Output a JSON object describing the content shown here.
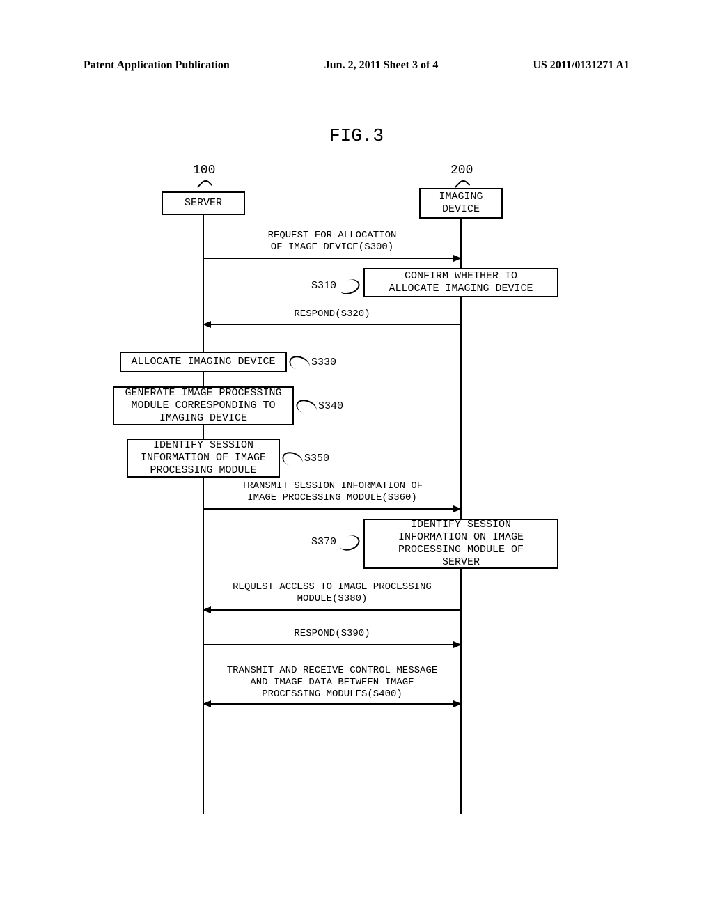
{
  "header": {
    "left": "Patent Application Publication",
    "center": "Jun. 2, 2011  Sheet 3 of 4",
    "right": "US 2011/0131271 A1"
  },
  "figure_title": "FIG.3",
  "refs": {
    "server": "100",
    "device": "200"
  },
  "entities": {
    "server": "SERVER",
    "device": "IMAGING\nDEVICE"
  },
  "steps": {
    "s300": "REQUEST FOR ALLOCATION\nOF IMAGE DEVICE(S300)",
    "s310_label": "S310",
    "s310_box": "CONFIRM WHETHER TO\nALLOCATE IMAGING DEVICE",
    "s320": "RESPOND(S320)",
    "s330_box": "ALLOCATE IMAGING DEVICE",
    "s330_label": "S330",
    "s340_box": "GENERATE IMAGE PROCESSING\nMODULE CORRESPONDING TO\nIMAGING DEVICE",
    "s340_label": "S340",
    "s350_box": "IDENTIFY SESSION\nINFORMATION OF IMAGE\nPROCESSING MODULE",
    "s350_label": "S350",
    "s360": "TRANSMIT SESSION INFORMATION OF\nIMAGE PROCESSING MODULE(S360)",
    "s370_label": "S370",
    "s370_box": "IDENTIFY SESSION\nINFORMATION ON IMAGE\nPROCESSING MODULE OF\nSERVER",
    "s380": "REQUEST ACCESS TO IMAGE PROCESSING\nMODULE(S380)",
    "s390": "RESPOND(S390)",
    "s400": "TRANSMIT AND RECEIVE CONTROL MESSAGE\nAND IMAGE DATA BETWEEN IMAGE\nPROCESSING MODULES(S400)"
  }
}
